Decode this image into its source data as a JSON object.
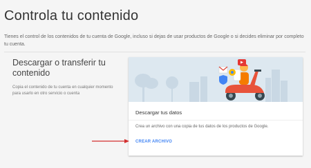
{
  "page": {
    "title": "Controla tu contenido",
    "description": "Tienes el control de los contenidos de tu cuenta de Google, incluso si dejas de usar productos de Google o si decides eliminar por completo tu cuenta."
  },
  "section": {
    "heading": "Descargar o transferir tu contenido",
    "description": "Copia el contenido de tu cuenta en cualquier momento para usarlo en otro servicio o cuenta"
  },
  "card": {
    "title": "Descargar tus datos",
    "text": "Crea un archivo con una copia de tus datos de los productos de Google.",
    "action_label": "CREAR ARCHIVO"
  },
  "colors": {
    "accent": "#4285f4",
    "illustration_bg": "#dde8f0",
    "scooter": "#e8533a",
    "arrow": "#d32f2f"
  },
  "icons": [
    "gmail-icon",
    "drive-icon",
    "youtube-icon",
    "security-shield-icon",
    "chrome-icon"
  ]
}
